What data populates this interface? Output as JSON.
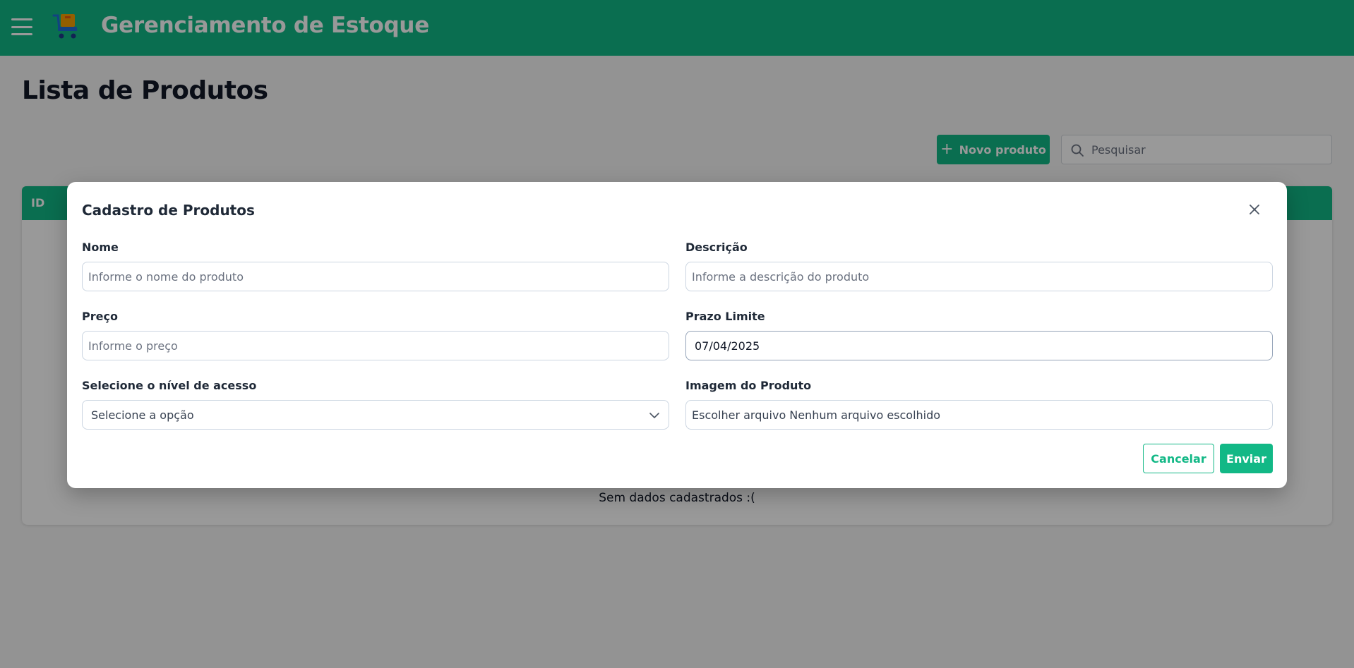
{
  "header": {
    "app_title": "Gerenciamento de Estoque",
    "menu_icon": "hamburger-menu-icon",
    "logo_icon": "shopping-cart-box-icon"
  },
  "page": {
    "title": "Lista de Produtos",
    "new_product_label": "Novo produto",
    "search_placeholder": "Pesquisar",
    "table": {
      "columns": [
        "ID"
      ],
      "empty_message": "Sem dados cadastrados :("
    }
  },
  "modal": {
    "title": "Cadastro de Produtos",
    "fields": {
      "nome": {
        "label": "Nome",
        "placeholder": "Informe o nome do produto"
      },
      "descricao": {
        "label": "Descrição",
        "placeholder": "Informe a descrição do produto"
      },
      "preco": {
        "label": "Preço",
        "placeholder": "Informe o preço"
      },
      "prazo": {
        "label": "Prazo Limite",
        "value": "07/04/2025"
      },
      "nivel": {
        "label": "Selecione o nível de acesso",
        "selected": "Selecione a opção"
      },
      "imagem": {
        "label": "Imagem do Produto",
        "button": "Escolher arquivo",
        "status": "Nenhum arquivo escolhido"
      }
    },
    "cancel_label": "Cancelar",
    "submit_label": "Enviar"
  },
  "colors": {
    "primary": "#12b886",
    "overlay": "rgba(0,0,0,0.4)"
  }
}
